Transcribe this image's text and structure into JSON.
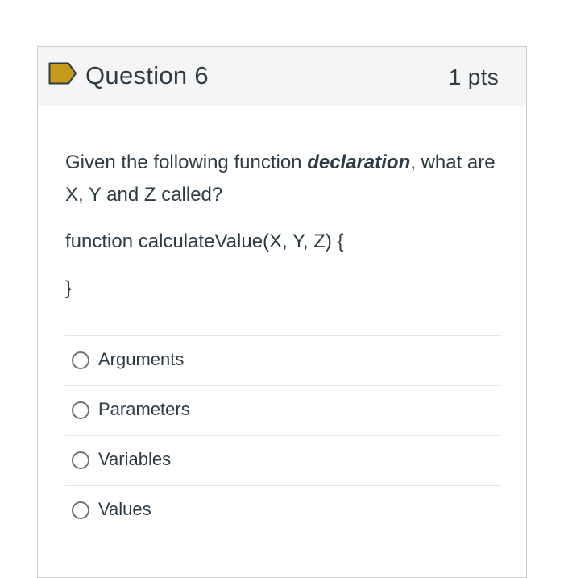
{
  "header": {
    "title": "Question 6",
    "points": "1 pts",
    "flag_icon": "bookmark-flag-icon",
    "flag_color": "#c49a1a"
  },
  "question": {
    "text_before": "Given the following function ",
    "text_emphasis": "declaration",
    "text_after": ", what are X, Y and Z called?",
    "code_line1": "function calculateValue(X, Y, Z) {",
    "code_line2": "}"
  },
  "answers": [
    {
      "label": "Arguments",
      "selected": false
    },
    {
      "label": "Parameters",
      "selected": false
    },
    {
      "label": "Variables",
      "selected": false
    },
    {
      "label": "Values",
      "selected": false
    }
  ]
}
